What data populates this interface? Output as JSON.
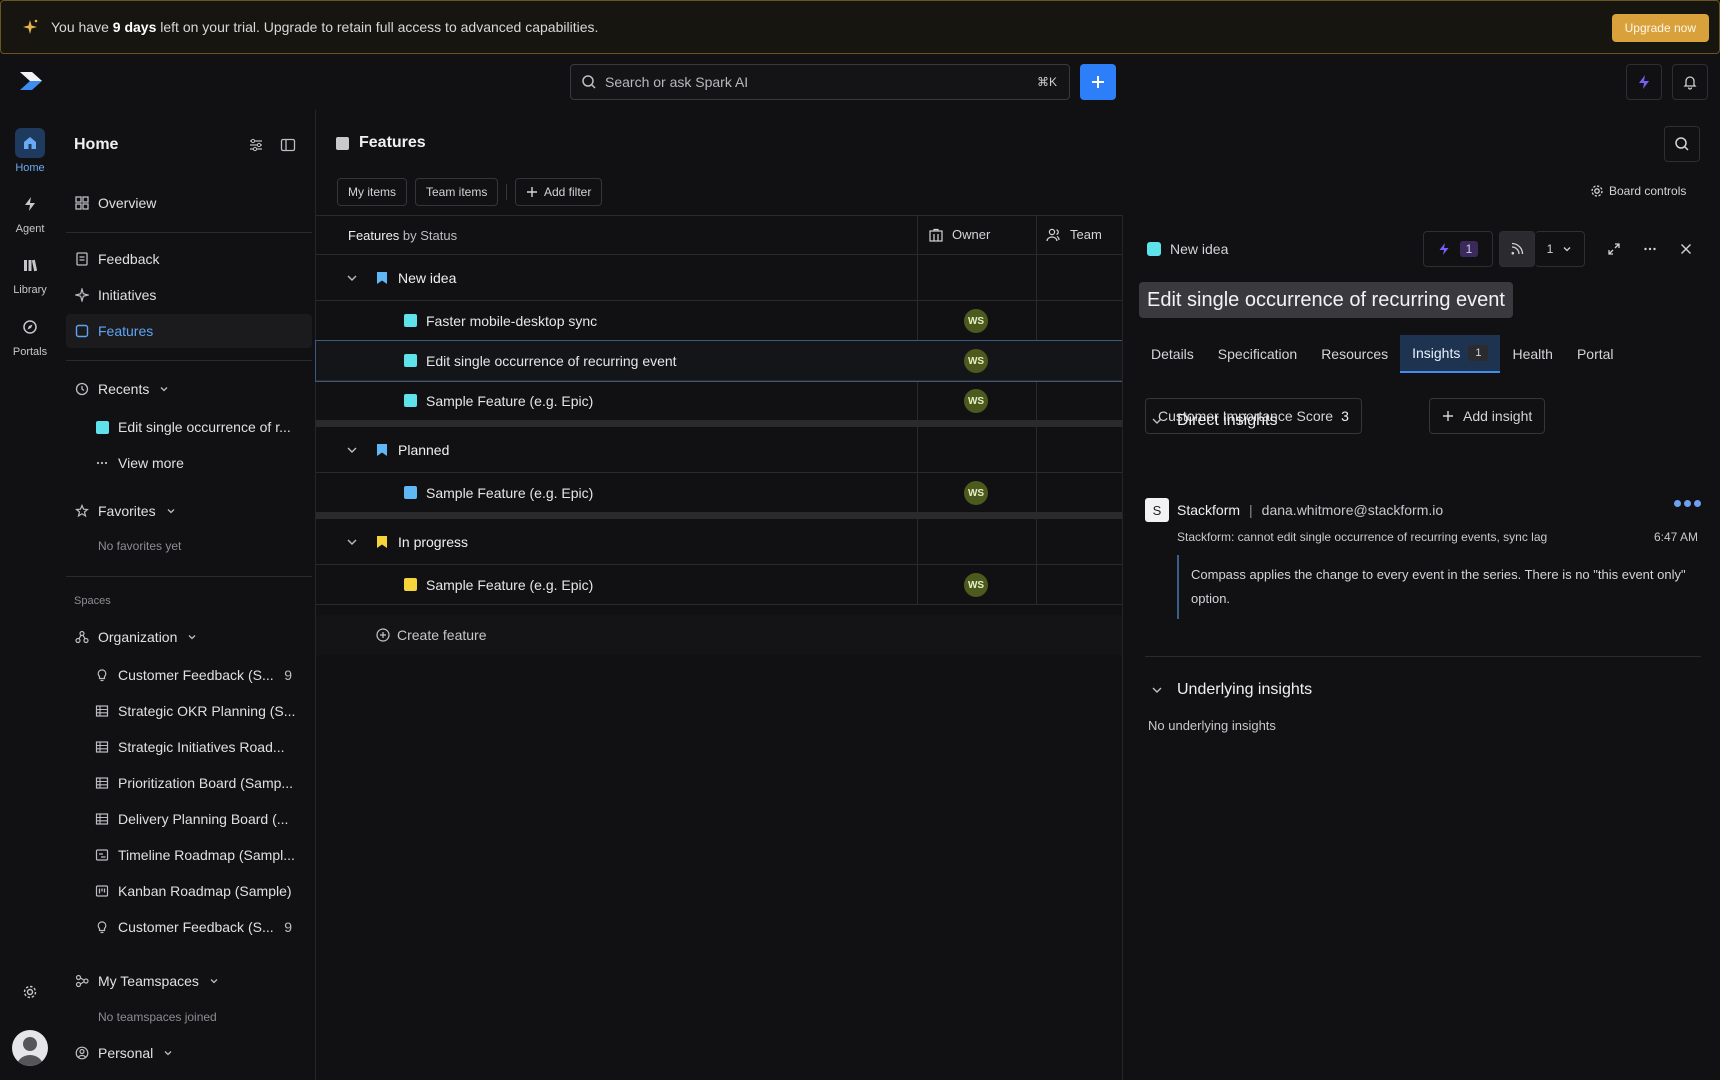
{
  "banner": {
    "prefix": "You have ",
    "days": "9 days",
    "suffix": " left on your trial. Upgrade to retain full access to advanced capabilities.",
    "cta": "Upgrade now"
  },
  "topbar": {
    "search_placeholder": "Search or ask Spark AI",
    "shortcut": "⌘K",
    "accent": "#2d7ff9"
  },
  "rail": [
    {
      "label": "Home",
      "icon": "home-icon",
      "active": true
    },
    {
      "label": "Agent",
      "icon": "bolt-icon"
    },
    {
      "label": "Library",
      "icon": "library-icon"
    },
    {
      "label": "Portals",
      "icon": "compass-icon"
    }
  ],
  "sidebar": {
    "title": "Home",
    "overview": "Overview",
    "feedback": "Feedback",
    "initiatives": "Initiatives",
    "features": "Features",
    "recents": "Recents",
    "recent_item": "Edit single occurrence of r...",
    "view_more": "View more",
    "favorites": "Favorites",
    "no_favorites": "No favorites yet",
    "spaces": "Spaces",
    "organization": "Organization",
    "space_items": [
      {
        "label": "Customer Feedback (S...",
        "count": "9",
        "icon": "bulb-icon"
      },
      {
        "label": "Strategic OKR Planning (S...",
        "icon": "table-icon"
      },
      {
        "label": "Strategic Initiatives Road...",
        "icon": "table-icon"
      },
      {
        "label": "Prioritization Board (Samp...",
        "icon": "table-icon"
      },
      {
        "label": "Delivery Planning Board (...",
        "icon": "table-icon"
      },
      {
        "label": "Timeline Roadmap (Sampl...",
        "icon": "timeline-icon"
      },
      {
        "label": "Kanban Roadmap (Sample)",
        "icon": "kanban-icon"
      },
      {
        "label": "Customer Feedback (S...",
        "count": "9",
        "icon": "bulb-icon"
      }
    ],
    "my_teamspaces": "My Teamspaces",
    "no_teamspaces": "No teamspaces joined",
    "personal": "Personal"
  },
  "main": {
    "title": "Features",
    "filters": {
      "my_items": "My items",
      "team_items": "Team items",
      "add_filter": "Add filter"
    },
    "board_controls": "Board controls",
    "grid_title_bold": "Features",
    "grid_title_rest": " by Status",
    "col_owner": "Owner",
    "col_team": "Team",
    "groups": [
      {
        "name": "New idea",
        "color": "#5fb8f5",
        "features": [
          {
            "name": "Faster mobile-desktop sync",
            "color": "#5fe3ea",
            "owner": "WS"
          },
          {
            "name": "Edit single occurrence of recurring event",
            "color": "#5fe3ea",
            "owner": "WS",
            "selected": true
          },
          {
            "name": "Sample Feature (e.g. Epic)",
            "color": "#5fe3ea",
            "owner": "WS"
          }
        ]
      },
      {
        "name": "Planned",
        "color": "#5fb8f5",
        "features": [
          {
            "name": "Sample Feature (e.g. Epic)",
            "color": "#5fb8f5",
            "owner": "WS"
          }
        ]
      },
      {
        "name": "In progress",
        "color": "#f5d33b",
        "features": [
          {
            "name": "Sample Feature (e.g. Epic)",
            "color": "#f5d33b",
            "owner": "WS"
          }
        ]
      }
    ],
    "create_feature": "Create feature"
  },
  "panel": {
    "status": "New idea",
    "spark_count": "1",
    "follow_count": "1",
    "title": "Edit single occurrence of recurring event",
    "tabs": [
      {
        "label": "Details"
      },
      {
        "label": "Specification"
      },
      {
        "label": "Resources"
      },
      {
        "label": "Insights",
        "badge": "1",
        "active": true
      },
      {
        "label": "Health"
      },
      {
        "label": "Portal"
      }
    ],
    "score_label": "Customer Importance Score",
    "score_value": "3",
    "add_insight": "Add insight",
    "direct_insights": "Direct insights",
    "insight": {
      "source_initial": "S",
      "source": "Stackform",
      "sep": "|",
      "email": "dana.whitmore@stackform.io",
      "subject": "Stackform: cannot edit single occurrence of recurring events, sync lag",
      "time": "6:47 AM",
      "quote": "Compass applies the change to every event in the series. There is no \"this event only\" option."
    },
    "underlying_insights": "Underlying insights",
    "no_underlying": "No underlying insights"
  }
}
